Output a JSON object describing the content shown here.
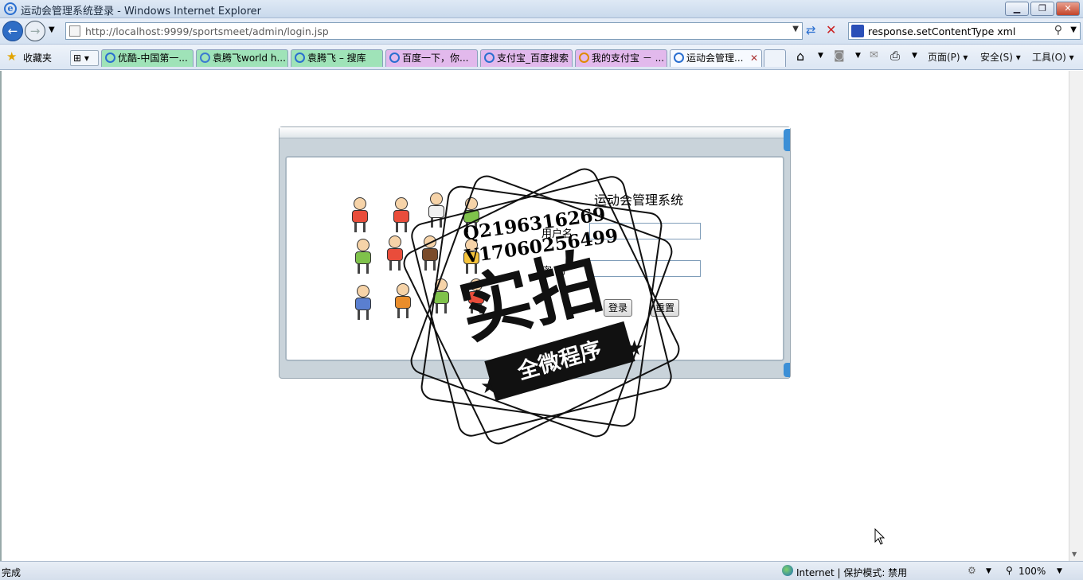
{
  "window": {
    "title": "运动会管理系统登录 - Windows Internet Explorer"
  },
  "nav": {
    "url": "http://localhost:9999/sportsmeet/admin/login.jsp",
    "search_text": "response.setContentType xml"
  },
  "favorites": {
    "label": "收藏夹"
  },
  "tabs": [
    {
      "label": "优酷-中国第一...",
      "color": "#9fe3b8"
    },
    {
      "label": "袁腾飞world h...",
      "color": "#9fe3b8"
    },
    {
      "label": "袁腾飞 – 搜库",
      "color": "#9fe3b8"
    },
    {
      "label": "百度一下，你...",
      "color": "#e2b9ec"
    },
    {
      "label": "支付宝_百度搜索",
      "color": "#e2b9ec"
    },
    {
      "label": "我的支付宝 － ...",
      "color": "#e2b9ec"
    },
    {
      "label": "运动会管理...",
      "color": "#f7faff"
    }
  ],
  "commands": {
    "page": "页面(P)",
    "safety": "安全(S)",
    "tools": "工具(O)"
  },
  "login": {
    "system_title": "运动会管理系统",
    "username_label": "用户名",
    "password_label": "密  码",
    "submit_label": "登录",
    "reset_label": "重置"
  },
  "watermark": {
    "line1": "Q2196316269",
    "line2": "V17060256499",
    "big": "实拍",
    "ribbon": "全微程序"
  },
  "status": {
    "left": "完成",
    "zone": "Internet | 保护模式: 禁用",
    "zoom": "100%"
  }
}
